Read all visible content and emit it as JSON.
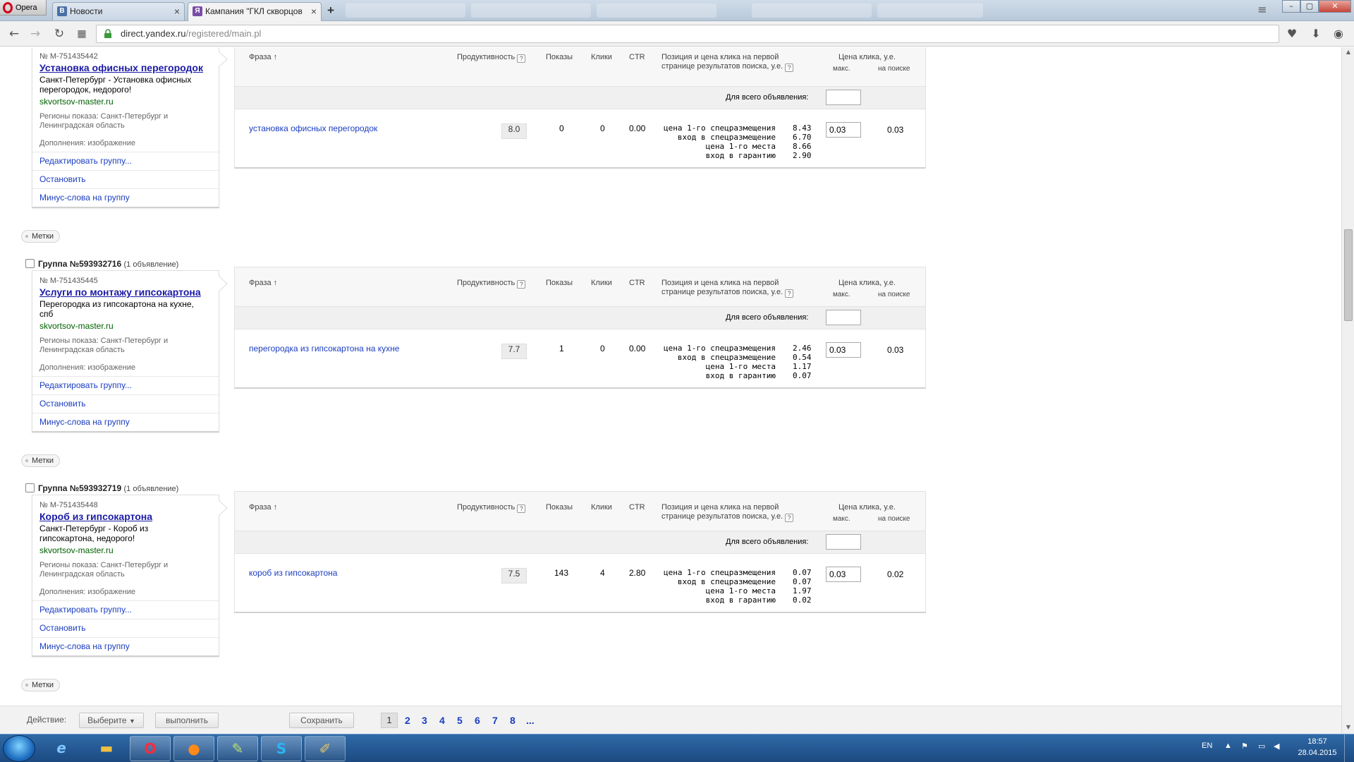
{
  "browser": {
    "opera_label": "Opera",
    "tabs": [
      {
        "label": "Новости",
        "icon_letter": "В",
        "icon_color": "#4a6fa5"
      },
      {
        "label": "Кампания \"ГКЛ скворцов",
        "icon_letter": "Я",
        "icon_color": "#7a4ca8"
      }
    ],
    "new_tab": "+",
    "url_host": "direct.yandex.ru",
    "url_path": "/registered/main.pl",
    "win_min": "–",
    "win_max": "▢",
    "win_close": "✕"
  },
  "columns": {
    "phrase": "Фраза",
    "phrase_sort": "↑",
    "productivity": "Продуктивность",
    "help": "?",
    "shows": "Показы",
    "clicks": "Клики",
    "ctr": "CTR",
    "position_l1": "Позиция и цена клика на первой",
    "position_l2": "странице результатов поиска, у.е.",
    "price": "Цена клика, у.е.",
    "price_max": "макс.",
    "price_search": "на поиске",
    "for_all_ads": "Для всего объявления:"
  },
  "position_labels": [
    "цена 1-го спецразмещения",
    "вход в спецразмещение",
    "цена 1-го места",
    "вход в гарантию"
  ],
  "card_actions": {
    "edit": "Редактировать группу...",
    "stop": "Остановить",
    "minus": "Минус-слова на группу"
  },
  "tags_label": "Метки",
  "groups": [
    {
      "title": "",
      "count": "",
      "ad_number": "№ M-751435442",
      "ad_title": "Установка офисных перегородок",
      "ad_body": [
        "Санкт-Петербург - Установка офисных",
        "перегородок, недорого!"
      ],
      "site": "skvortsov-master.ru",
      "regions": [
        "Регионы показа: Санкт-Петербург и",
        "Ленинградская область"
      ],
      "extras": "Дополнения: изображение",
      "phrase": "установка офисных перегородок",
      "productivity": "8.0",
      "shows": "0",
      "clicks": "0",
      "ctr": "0.00",
      "pos_values": [
        "8.43",
        "6.70",
        "8.66",
        "2.90"
      ],
      "bid": "0.03",
      "search_price": "0.03"
    },
    {
      "title": "Группа №593932716",
      "count": "(1 объявление)",
      "ad_number": "№ M-751435445",
      "ad_title": "Услуги по монтажу гипсокартона",
      "ad_body": [
        "Перегородка из гипсокартона на кухне,",
        "спб"
      ],
      "site": "skvortsov-master.ru",
      "regions": [
        "Регионы показа: Санкт-Петербург и",
        "Ленинградская область"
      ],
      "extras": "Дополнения: изображение",
      "phrase": "перегородка из гипсокартона на кухне",
      "productivity": "7.7",
      "shows": "1",
      "clicks": "0",
      "ctr": "0.00",
      "pos_values": [
        "2.46",
        "0.54",
        "1.17",
        "0.07"
      ],
      "bid": "0.03",
      "search_price": "0.03"
    },
    {
      "title": "Группа №593932719",
      "count": "(1 объявление)",
      "ad_number": "№ M-751435448",
      "ad_title": "Короб из гипсокартона",
      "ad_body": [
        "Санкт-Петербург - Короб из",
        "гипсокартона, недорого!"
      ],
      "site": "skvortsov-master.ru",
      "regions": [
        "Регионы показа: Санкт-Петербург и",
        "Ленинградская область"
      ],
      "extras": "Дополнения: изображение",
      "phrase": "короб из гипсокартона",
      "productivity": "7.5",
      "shows": "143",
      "clicks": "4",
      "ctr": "2.80",
      "pos_values": [
        "0.07",
        "0.07",
        "1.97",
        "0.02"
      ],
      "bid": "0.03",
      "search_price": "0.02"
    }
  ],
  "bottom_bar": {
    "action_label": "Действие:",
    "select_label": "Выберите",
    "run_label": "выполнить",
    "save_label": "Сохранить",
    "pages": [
      "1",
      "2",
      "3",
      "4",
      "5",
      "6",
      "7",
      "8",
      "..."
    ],
    "current_page": "1"
  },
  "taskbar": {
    "lang": "EN",
    "time": "18:57",
    "date": "28.04.2015"
  },
  "colors": {
    "link": "#1a3dc1",
    "site_green": "#006000",
    "opera_red": "#d0021b"
  }
}
